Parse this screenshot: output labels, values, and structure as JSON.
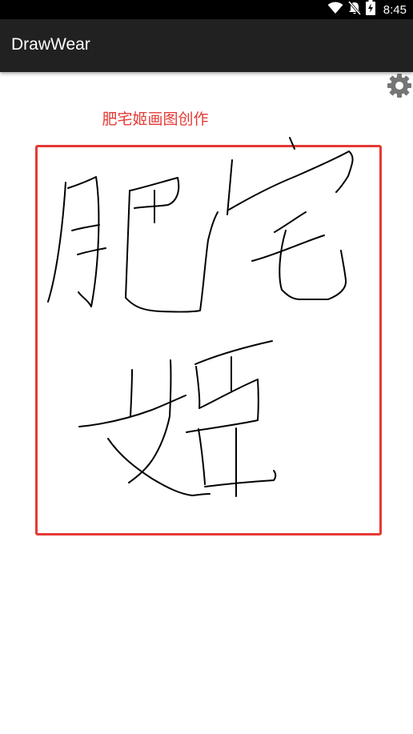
{
  "status_bar": {
    "time": "8:45",
    "icons": [
      "wifi-icon",
      "mute-icon",
      "battery-charging-icon"
    ]
  },
  "app_bar": {
    "title": "DrawWear"
  },
  "toolbar": {
    "settings_icon": "gear-icon"
  },
  "content": {
    "subtitle": "肥宅姬画图创作"
  },
  "colors": {
    "accent": "#e53935",
    "app_bar_bg": "#212121",
    "status_bar_bg": "#000000",
    "stroke": "#000000"
  }
}
